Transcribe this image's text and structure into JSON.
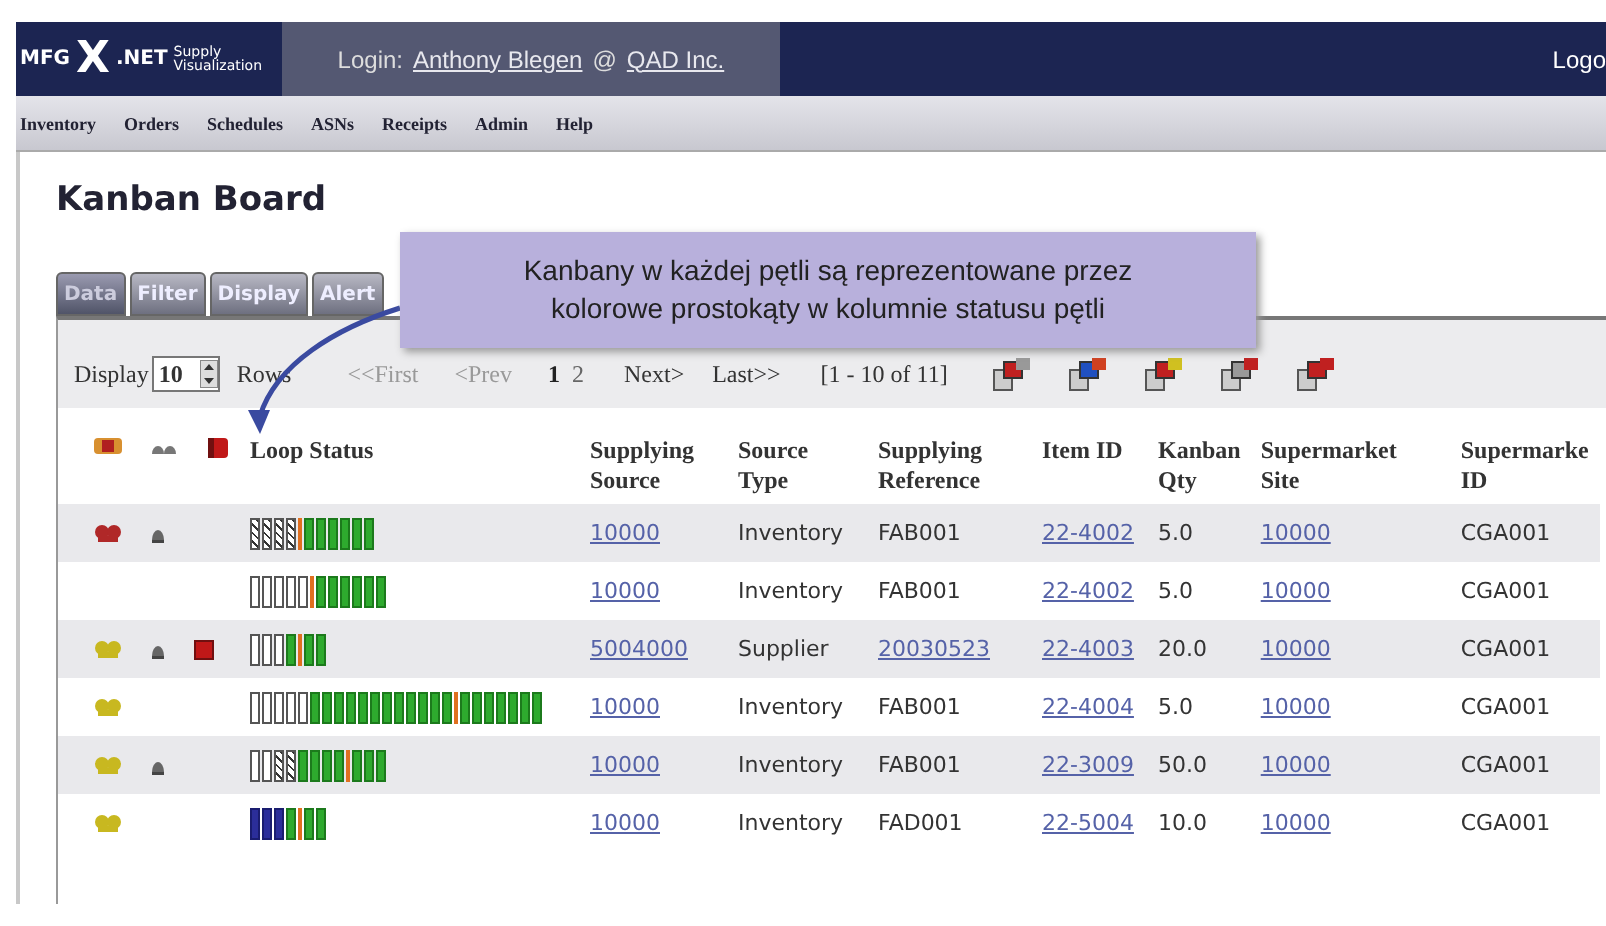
{
  "header": {
    "logo_brand": "MFG",
    "logo_mark": "X",
    "logo_net": ".NET",
    "logo_tagline": "Supply Visualization",
    "login_label": "Login:",
    "user": "Anthony Blegen",
    "at": "@",
    "company": "QAD Inc.",
    "logout": "Logo"
  },
  "menu": [
    {
      "label": "Inventory"
    },
    {
      "label": "Orders"
    },
    {
      "label": "Schedules"
    },
    {
      "label": "ASNs"
    },
    {
      "label": "Receipts"
    },
    {
      "label": "Admin"
    },
    {
      "label": "Help"
    }
  ],
  "page_title": "Kanban Board",
  "tabs": [
    {
      "label": "Data",
      "selected": true
    },
    {
      "label": "Filter",
      "selected": false
    },
    {
      "label": "Display",
      "selected": false
    },
    {
      "label": "Alert",
      "selected": false
    }
  ],
  "callout": {
    "line_1": "Kanbany w każdej pętli są reprezentowane przez",
    "line_2": "kolorowe prostokąty w kolumnie statusu pętli"
  },
  "pager": {
    "display_label": "Display",
    "rows_value": "10",
    "rows_label": "Rows",
    "first": "<<First",
    "prev": "<Prev",
    "pages": [
      {
        "label": "1",
        "selected": true
      },
      {
        "label": "2",
        "selected": false
      }
    ],
    "next": "Next>",
    "last": "Last>>",
    "range": "[1 - 10 of 11]"
  },
  "table": {
    "columns": [
      "Loop Status",
      "Supplying Source",
      "Source Type",
      "Supplying Reference",
      "Item ID",
      "Kanban Qty",
      "Supermarket Site",
      "Supermarke ID"
    ],
    "rows": [
      {
        "signal": {
          "color": "#b02828"
        },
        "bell": true,
        "flag": false,
        "loop": [
          {
            "kind": "partial"
          },
          {
            "kind": "partial"
          },
          {
            "kind": "partial"
          },
          {
            "kind": "partial"
          },
          {
            "kind": "marker"
          },
          {
            "kind": "full"
          },
          {
            "kind": "full"
          },
          {
            "kind": "full"
          },
          {
            "kind": "full"
          },
          {
            "kind": "full"
          },
          {
            "kind": "full"
          }
        ],
        "supplying_source": "10000",
        "source_type": "Inventory",
        "supplying_reference": "FAB001",
        "reference_link": false,
        "item_id": "22-4002",
        "kanban_qty": "5.0",
        "supermarket_site": "10000",
        "supermarket_id": "CGA001"
      },
      {
        "signal": null,
        "bell": false,
        "flag": false,
        "loop": [
          {
            "kind": "empty"
          },
          {
            "kind": "empty"
          },
          {
            "kind": "empty"
          },
          {
            "kind": "empty"
          },
          {
            "kind": "empty"
          },
          {
            "kind": "marker"
          },
          {
            "kind": "full"
          },
          {
            "kind": "full"
          },
          {
            "kind": "full"
          },
          {
            "kind": "full"
          },
          {
            "kind": "full"
          },
          {
            "kind": "full"
          }
        ],
        "supplying_source": "10000",
        "source_type": "Inventory",
        "supplying_reference": "FAB001",
        "reference_link": false,
        "item_id": "22-4002",
        "kanban_qty": "5.0",
        "supermarket_site": "10000",
        "supermarket_id": "CGA001"
      },
      {
        "signal": {
          "color": "#c8b820"
        },
        "bell": true,
        "flag": true,
        "loop": [
          {
            "kind": "empty"
          },
          {
            "kind": "empty"
          },
          {
            "kind": "empty"
          },
          {
            "kind": "full"
          },
          {
            "kind": "marker"
          },
          {
            "kind": "full"
          },
          {
            "kind": "full"
          }
        ],
        "supplying_source": "5004000",
        "source_type": "Supplier",
        "supplying_reference": "20030523",
        "reference_link": true,
        "item_id": "22-4003",
        "kanban_qty": "20.0",
        "supermarket_site": "10000",
        "supermarket_id": "CGA001"
      },
      {
        "signal": {
          "color": "#c8b820"
        },
        "bell": false,
        "flag": false,
        "loop": [
          {
            "kind": "empty"
          },
          {
            "kind": "empty"
          },
          {
            "kind": "empty"
          },
          {
            "kind": "empty"
          },
          {
            "kind": "empty"
          },
          {
            "kind": "full"
          },
          {
            "kind": "full"
          },
          {
            "kind": "full"
          },
          {
            "kind": "full"
          },
          {
            "kind": "full"
          },
          {
            "kind": "full"
          },
          {
            "kind": "full"
          },
          {
            "kind": "full"
          },
          {
            "kind": "full"
          },
          {
            "kind": "full"
          },
          {
            "kind": "full"
          },
          {
            "kind": "full"
          },
          {
            "kind": "marker"
          },
          {
            "kind": "full"
          },
          {
            "kind": "full"
          },
          {
            "kind": "full"
          },
          {
            "kind": "full"
          },
          {
            "kind": "full"
          },
          {
            "kind": "full"
          },
          {
            "kind": "full"
          }
        ],
        "supplying_source": "10000",
        "source_type": "Inventory",
        "supplying_reference": "FAB001",
        "reference_link": false,
        "item_id": "22-4004",
        "kanban_qty": "5.0",
        "supermarket_site": "10000",
        "supermarket_id": "CGA001"
      },
      {
        "signal": {
          "color": "#c8b820"
        },
        "bell": true,
        "flag": false,
        "loop": [
          {
            "kind": "empty"
          },
          {
            "kind": "empty"
          },
          {
            "kind": "partial"
          },
          {
            "kind": "partial"
          },
          {
            "kind": "full"
          },
          {
            "kind": "full"
          },
          {
            "kind": "full"
          },
          {
            "kind": "full"
          },
          {
            "kind": "marker"
          },
          {
            "kind": "full"
          },
          {
            "kind": "full"
          },
          {
            "kind": "full"
          }
        ],
        "supplying_source": "10000",
        "source_type": "Inventory",
        "supplying_reference": "FAB001",
        "reference_link": false,
        "item_id": "22-3009",
        "kanban_qty": "50.0",
        "supermarket_site": "10000",
        "supermarket_id": "CGA001"
      },
      {
        "signal": {
          "color": "#c8b820"
        },
        "bell": false,
        "flag": false,
        "loop": [
          {
            "kind": "blue"
          },
          {
            "kind": "blue"
          },
          {
            "kind": "blue"
          },
          {
            "kind": "full"
          },
          {
            "kind": "marker"
          },
          {
            "kind": "full"
          },
          {
            "kind": "full"
          }
        ],
        "supplying_source": "10000",
        "source_type": "Inventory",
        "supplying_reference": "FAD001",
        "reference_link": false,
        "item_id": "22-5004",
        "kanban_qty": "10.0",
        "supermarket_site": "10000",
        "supermarket_id": "CGA001"
      }
    ]
  }
}
